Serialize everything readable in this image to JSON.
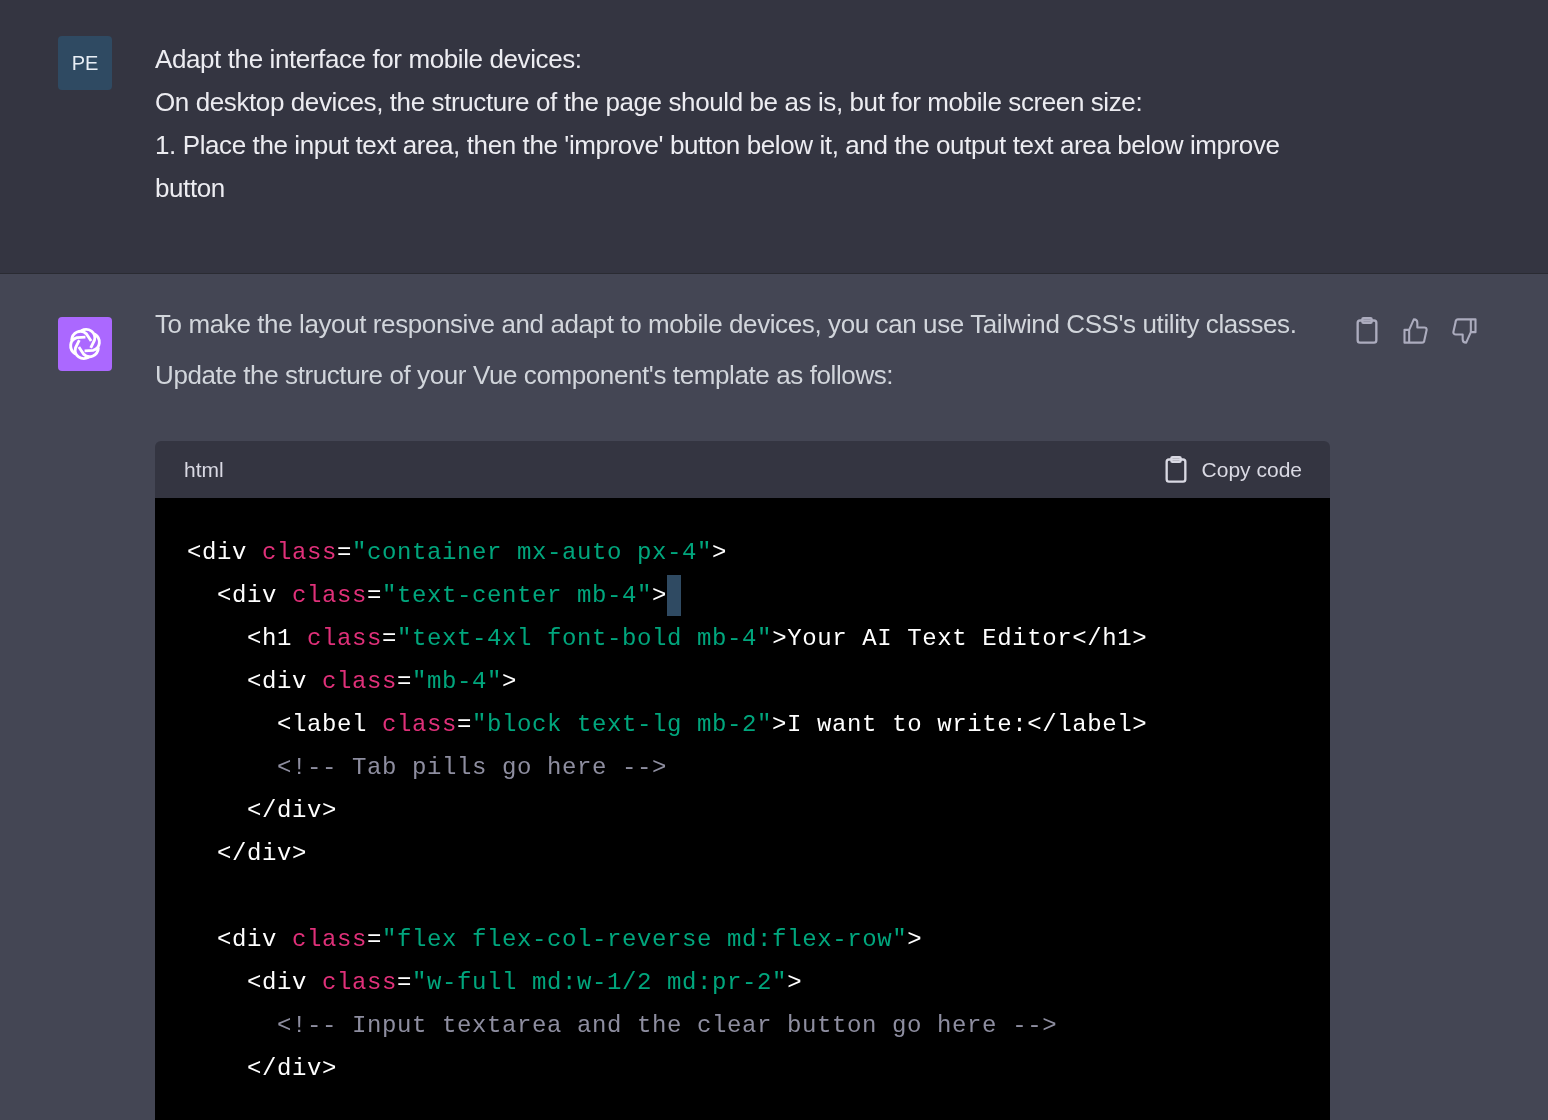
{
  "user_message": {
    "avatar": "PE",
    "lines": [
      "Adapt the interface for mobile devices:",
      "On desktop devices, the structure of the page should be as is, but for mobile screen size:",
      "1. Place the input text area, then the  'improve' button below it, and the output text area below improve button"
    ]
  },
  "assistant_message": {
    "text": "To make the layout responsive and adapt to mobile devices, you can use Tailwind CSS's utility classes. Update the structure of your Vue component's template as follows:",
    "code_block": {
      "language": "html",
      "copy_label": "Copy code",
      "lines": [
        {
          "kind": "code",
          "cursor": false,
          "tokens": [
            {
              "kind": "plain",
              "text": "<div "
            },
            {
              "kind": "attr",
              "text": "class"
            },
            {
              "kind": "plain",
              "text": "="
            },
            {
              "kind": "string",
              "text": "\"container mx-auto px-4\""
            },
            {
              "kind": "plain",
              "text": ">"
            }
          ]
        },
        {
          "kind": "code",
          "cursor": true,
          "tokens": [
            {
              "kind": "plain",
              "text": "  <div "
            },
            {
              "kind": "attr",
              "text": "class"
            },
            {
              "kind": "plain",
              "text": "="
            },
            {
              "kind": "string",
              "text": "\"text-center mb-4\""
            },
            {
              "kind": "plain",
              "text": ">"
            }
          ]
        },
        {
          "kind": "code",
          "cursor": false,
          "tokens": [
            {
              "kind": "plain",
              "text": "    <h1 "
            },
            {
              "kind": "attr",
              "text": "class"
            },
            {
              "kind": "plain",
              "text": "="
            },
            {
              "kind": "string",
              "text": "\"text-4xl font-bold mb-4\""
            },
            {
              "kind": "plain",
              "text": ">Your AI Text Editor</h1>"
            }
          ]
        },
        {
          "kind": "code",
          "cursor": false,
          "tokens": [
            {
              "kind": "plain",
              "text": "    <div "
            },
            {
              "kind": "attr",
              "text": "class"
            },
            {
              "kind": "plain",
              "text": "="
            },
            {
              "kind": "string",
              "text": "\"mb-4\""
            },
            {
              "kind": "plain",
              "text": ">"
            }
          ]
        },
        {
          "kind": "code",
          "cursor": false,
          "tokens": [
            {
              "kind": "plain",
              "text": "      <label "
            },
            {
              "kind": "attr",
              "text": "class"
            },
            {
              "kind": "plain",
              "text": "="
            },
            {
              "kind": "string",
              "text": "\"block text-lg mb-2\""
            },
            {
              "kind": "plain",
              "text": ">I want to write:</label>"
            }
          ]
        },
        {
          "kind": "code",
          "cursor": false,
          "tokens": [
            {
              "kind": "comment",
              "text": "      <!-- Tab pills go here -->"
            }
          ]
        },
        {
          "kind": "code",
          "cursor": false,
          "tokens": [
            {
              "kind": "plain",
              "text": "    </div>"
            }
          ]
        },
        {
          "kind": "code",
          "cursor": false,
          "tokens": [
            {
              "kind": "plain",
              "text": "  </div>"
            }
          ]
        },
        {
          "kind": "blank"
        },
        {
          "kind": "code",
          "cursor": false,
          "tokens": [
            {
              "kind": "plain",
              "text": "  <div "
            },
            {
              "kind": "attr",
              "text": "class"
            },
            {
              "kind": "plain",
              "text": "="
            },
            {
              "kind": "string",
              "text": "\"flex flex-col-reverse md:flex-row\""
            },
            {
              "kind": "plain",
              "text": ">"
            }
          ]
        },
        {
          "kind": "code",
          "cursor": false,
          "tokens": [
            {
              "kind": "plain",
              "text": "    <div "
            },
            {
              "kind": "attr",
              "text": "class"
            },
            {
              "kind": "plain",
              "text": "="
            },
            {
              "kind": "string",
              "text": "\"w-full md:w-1/2 md:pr-2\""
            },
            {
              "kind": "plain",
              "text": ">"
            }
          ]
        },
        {
          "kind": "code",
          "cursor": false,
          "tokens": [
            {
              "kind": "comment",
              "text": "      <!-- Input textarea and the clear button go here -->"
            }
          ]
        },
        {
          "kind": "code",
          "cursor": false,
          "tokens": [
            {
              "kind": "plain",
              "text": "    </div>"
            }
          ]
        }
      ]
    }
  }
}
